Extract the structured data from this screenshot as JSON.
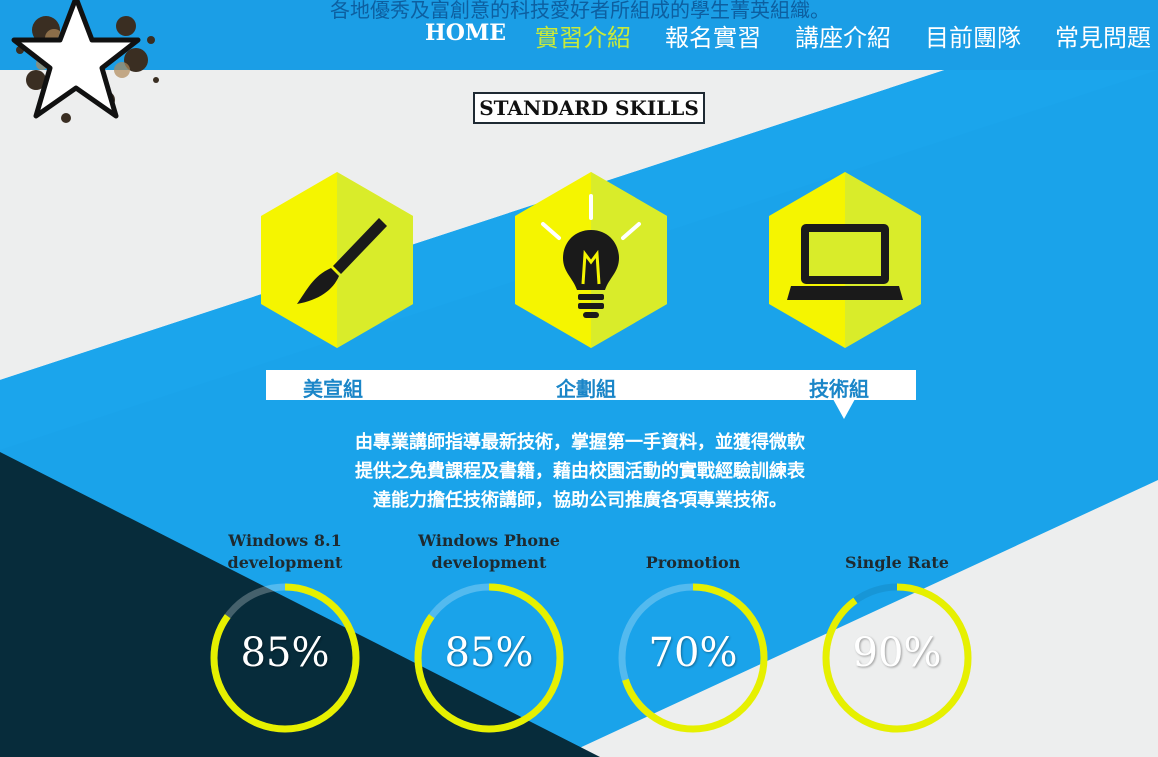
{
  "header": {
    "tagline": "各地優秀及富創意的科技愛好者所組成的學生菁英組織。",
    "nav": [
      {
        "label": "HOME"
      },
      {
        "label": "實習介紹"
      },
      {
        "label": "報名實習"
      },
      {
        "label": "講座介紹"
      },
      {
        "label": "目前團隊"
      },
      {
        "label": "常見問題"
      }
    ],
    "active_nav": "實習介紹",
    "logo_icon": "star-logo-icon"
  },
  "skills_section": {
    "title": "STANDARD SKILLS",
    "groups": [
      {
        "label": "美宣組",
        "icon": "paintbrush-icon"
      },
      {
        "label": "企劃組",
        "icon": "lightbulb-icon"
      },
      {
        "label": "技術組",
        "icon": "laptop-icon"
      }
    ],
    "selected_group": "技術組",
    "description": [
      "由專業講師指導最新技術，掌握第一手資料，並獲得微軟",
      "提供之免費課程及書籍，藉由校園活動的實戰經驗訓練表",
      "達能力擔任技術講師，協助公司推廣各項專業技術。"
    ]
  },
  "progress": [
    {
      "title_line1": "Windows 8.1",
      "title_line2": "development",
      "value_text": "85%",
      "value": 0.85
    },
    {
      "title_line1": "Windows Phone",
      "title_line2": "development",
      "value_text": "85%",
      "value": 0.85
    },
    {
      "title_line1": "",
      "title_line2": "Promotion",
      "value_text": "70%",
      "value": 0.7
    },
    {
      "title_line1": "",
      "title_line2": "Single Rate",
      "value_text": "90%",
      "value": 0.9
    }
  ],
  "colors": {
    "accent_blue": "#1b9ee6",
    "hex_yellow": "#f5f500",
    "hex_lime": "#cfe92e",
    "ring_yellow": "#e6f000",
    "dark_navy": "#072c3b",
    "light_gray": "#edeeee"
  }
}
